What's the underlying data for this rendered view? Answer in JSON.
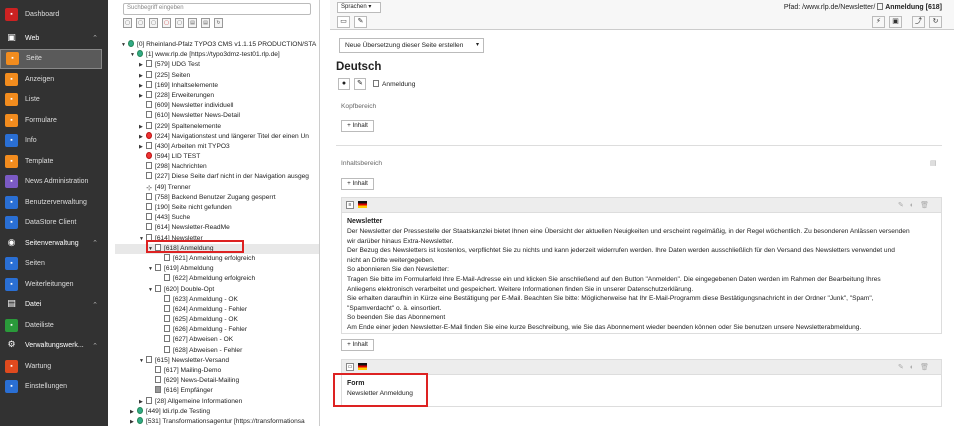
{
  "modules": [
    {
      "type": "top",
      "label": "Dashboard",
      "color": "#c22"
    },
    {
      "type": "group",
      "label": "Web",
      "icon": "▣"
    },
    {
      "type": "item",
      "label": "Seite",
      "color": "#f28c1e",
      "active": true
    },
    {
      "type": "item",
      "label": "Anzeigen",
      "color": "#f28c1e"
    },
    {
      "type": "item",
      "label": "Liste",
      "color": "#f28c1e"
    },
    {
      "type": "item",
      "label": "Formulare",
      "color": "#f28c1e"
    },
    {
      "type": "item",
      "label": "Info",
      "color": "#2a6fd4"
    },
    {
      "type": "item",
      "label": "Template",
      "color": "#f28c1e"
    },
    {
      "type": "item",
      "label": "News Administration",
      "color": "#7b5ac4"
    },
    {
      "type": "item",
      "label": "Benutzerverwaltung",
      "color": "#2a6fd4"
    },
    {
      "type": "item",
      "label": "DataStore Client",
      "color": "#2a6fd4"
    },
    {
      "type": "group",
      "label": "Seitenverwaltung",
      "icon": "◉"
    },
    {
      "type": "item",
      "label": "Seiten",
      "color": "#2a6fd4"
    },
    {
      "type": "item",
      "label": "Weiterleitungen",
      "color": "#2a6fd4"
    },
    {
      "type": "group",
      "label": "Datei",
      "icon": "▤"
    },
    {
      "type": "item",
      "label": "Dateiliste",
      "color": "#2a9a3a"
    },
    {
      "type": "group",
      "label": "Verwaltungswerk...",
      "icon": "⚙"
    },
    {
      "type": "item",
      "label": "Wartung",
      "color": "#e04a1e"
    },
    {
      "type": "item",
      "label": "Einstellungen",
      "color": "#2a6fd4"
    }
  ],
  "tree": {
    "search_placeholder": "Suchbegriff eingeben",
    "rows": [
      {
        "lvl": 0,
        "t": "▼",
        "ic": "globe",
        "label": "[0] Rheinland-Pfalz TYPO3 CMS v1.1.15 PRODUCTION/STA"
      },
      {
        "lvl": 1,
        "t": "▼",
        "ic": "globe",
        "label": "[1] www.rlp.de [https://typo3dmz-test01.rlp.de]"
      },
      {
        "lvl": 2,
        "t": "▶",
        "ic": "pg",
        "label": "[579] UDG Test"
      },
      {
        "lvl": 2,
        "t": "▶",
        "ic": "pg",
        "label": "[225] Seiten"
      },
      {
        "lvl": 2,
        "t": "▶",
        "ic": "pg",
        "label": "[169] Inhaltselemente"
      },
      {
        "lvl": 2,
        "t": "▶",
        "ic": "pg",
        "label": "[228] Erweiterungen"
      },
      {
        "lvl": 2,
        "t": "",
        "ic": "pg",
        "label": "[609] Newsletter individuell"
      },
      {
        "lvl": 2,
        "t": "",
        "ic": "pg",
        "label": "[610] Newsletter News-Detail"
      },
      {
        "lvl": 2,
        "t": "▶",
        "ic": "pg",
        "label": "[229] Spaltenelemente"
      },
      {
        "lvl": 2,
        "t": "▶",
        "ic": "red",
        "label": "[224] Navigationstest und längerer Titel der einen Un"
      },
      {
        "lvl": 2,
        "t": "▶",
        "ic": "pg",
        "label": "[430] Arbeiten mit TYPO3"
      },
      {
        "lvl": 2,
        "t": "",
        "ic": "red",
        "label": "[594] LID TEST"
      },
      {
        "lvl": 2,
        "t": "",
        "ic": "pg",
        "label": "[298] Nachrichten"
      },
      {
        "lvl": 2,
        "t": "",
        "ic": "pg",
        "label": "[227] Diese Seite darf nicht in der Navigation ausgeg"
      },
      {
        "lvl": 2,
        "t": "",
        "ic": "link",
        "label": "[49] Trenner"
      },
      {
        "lvl": 2,
        "t": "",
        "ic": "pg",
        "label": "[758] Backend Benutzer Zugang gesperrt"
      },
      {
        "lvl": 2,
        "t": "",
        "ic": "pg",
        "label": "[190] Seite nicht gefunden"
      },
      {
        "lvl": 2,
        "t": "",
        "ic": "pg",
        "label": "[443] Suche"
      },
      {
        "lvl": 2,
        "t": "",
        "ic": "pg",
        "label": "[614] Newsletter-ReadMe"
      },
      {
        "lvl": 2,
        "t": "▼",
        "ic": "pg",
        "label": "[614] Newsletter"
      },
      {
        "lvl": 3,
        "t": "▼",
        "ic": "pg",
        "label": "[618] Anmeldung",
        "sel": true
      },
      {
        "lvl": 4,
        "t": "",
        "ic": "pg",
        "label": "[621] Anmeldung erfolgreich"
      },
      {
        "lvl": 3,
        "t": "▼",
        "ic": "pg",
        "label": "[619] Abmeldung"
      },
      {
        "lvl": 4,
        "t": "",
        "ic": "pg",
        "label": "[622] Abmeldung erfolgreich"
      },
      {
        "lvl": 3,
        "t": "▼",
        "ic": "pg",
        "label": "[620] Double-Opt"
      },
      {
        "lvl": 4,
        "t": "",
        "ic": "pg",
        "label": "[623] Anmeldung - OK"
      },
      {
        "lvl": 4,
        "t": "",
        "ic": "pg",
        "label": "[624] Anmeldung - Fehler"
      },
      {
        "lvl": 4,
        "t": "",
        "ic": "pg",
        "label": "[625] Abmeldung - OK"
      },
      {
        "lvl": 4,
        "t": "",
        "ic": "pg",
        "label": "[626] Abmeldung - Fehler"
      },
      {
        "lvl": 4,
        "t": "",
        "ic": "pg",
        "label": "[627] Abweisen - OK"
      },
      {
        "lvl": 4,
        "t": "",
        "ic": "pg",
        "label": "[628] Abweisen - Fehler"
      },
      {
        "lvl": 2,
        "t": "▼",
        "ic": "pg",
        "label": "[615] Newsletter-Versand"
      },
      {
        "lvl": 3,
        "t": "",
        "ic": "pg",
        "label": "[617] Mailing-Demo"
      },
      {
        "lvl": 3,
        "t": "",
        "ic": "pg",
        "label": "[629] News-Detail-Mailing"
      },
      {
        "lvl": 3,
        "t": "",
        "ic": "dark",
        "label": "[616] Empfänger"
      },
      {
        "lvl": 2,
        "t": "▶",
        "ic": "pg",
        "label": "[28] Allgemeine Informationen"
      },
      {
        "lvl": 1,
        "t": "▶",
        "ic": "globe",
        "label": "[449] ldi.rlp.de Testing"
      },
      {
        "lvl": 1,
        "t": "▶",
        "ic": "globe",
        "label": "[531] Transformationsagentur [https://transformationsa"
      }
    ]
  },
  "header": {
    "language_select": "Sprachen",
    "path_prefix": "Pfad: /www.rlp.de/Newsletter/",
    "path_page": "Anmeldung [618]"
  },
  "content": {
    "new_translation": "Neue Übersetzung dieser Seite erstellen",
    "language_heading": "Deutsch",
    "page_title": "Anmeldung",
    "colpos_top": "Kopfbereich",
    "colpos_main": "Inhaltsbereich",
    "add_content": "+ Inhalt",
    "ce1_title": "Newsletter",
    "ce1_lines": [
      "Der Newsletter der Pressestelle der Staatskanzlei bietet Ihnen eine Übersicht der aktuellen Neuigkeiten und erscheint regelmäßig, in der Regel wöchentlich. Zu besonderen Anlässen versenden",
      "wir darüber hinaus Extra-Newsletter.",
      "Der Bezug des Newsletters ist kostenlos, verpflichtet Sie zu nichts und kann jederzeit widerrufen werden. Ihre Daten werden ausschließlich für den Versand des Newsletters verwendet und",
      "nicht an Dritte weitergegeben.",
      "So abonnieren Sie den Newsletter:",
      "Tragen Sie bitte im Formularfeld Ihre E-Mail-Adresse ein und klicken Sie anschließend auf den Button \"Anmelden\". Die eingegebenen Daten werden im Rahmen der Bearbeitung Ihres",
      "Anliegens elektronisch verarbeitet und gespeichert. Weitere Informationen finden Sie in unserer Datenschutzerklärung.",
      "Sie erhalten daraufhin in Kürze eine Bestätigung per E-Mail. Beachten Sie bitte: Möglicherweise hat Ihr E-Mail-Programm diese Bestätigungsnachricht in der Ordner \"Junk\", \"Spam\",",
      "\"Spamverdacht\" o. ä. einsortiert.",
      "So beenden Sie das Abonnement",
      "Am Ende einer jeden Newsletter-E-Mail finden Sie eine kurze Beschreibung, wie Sie das Abonnement wieder beenden können oder Sie benutzen unsere Newsletterabmeldung."
    ],
    "ce2_title": "Form",
    "ce2_text": "Newsletter Anmeldung"
  }
}
